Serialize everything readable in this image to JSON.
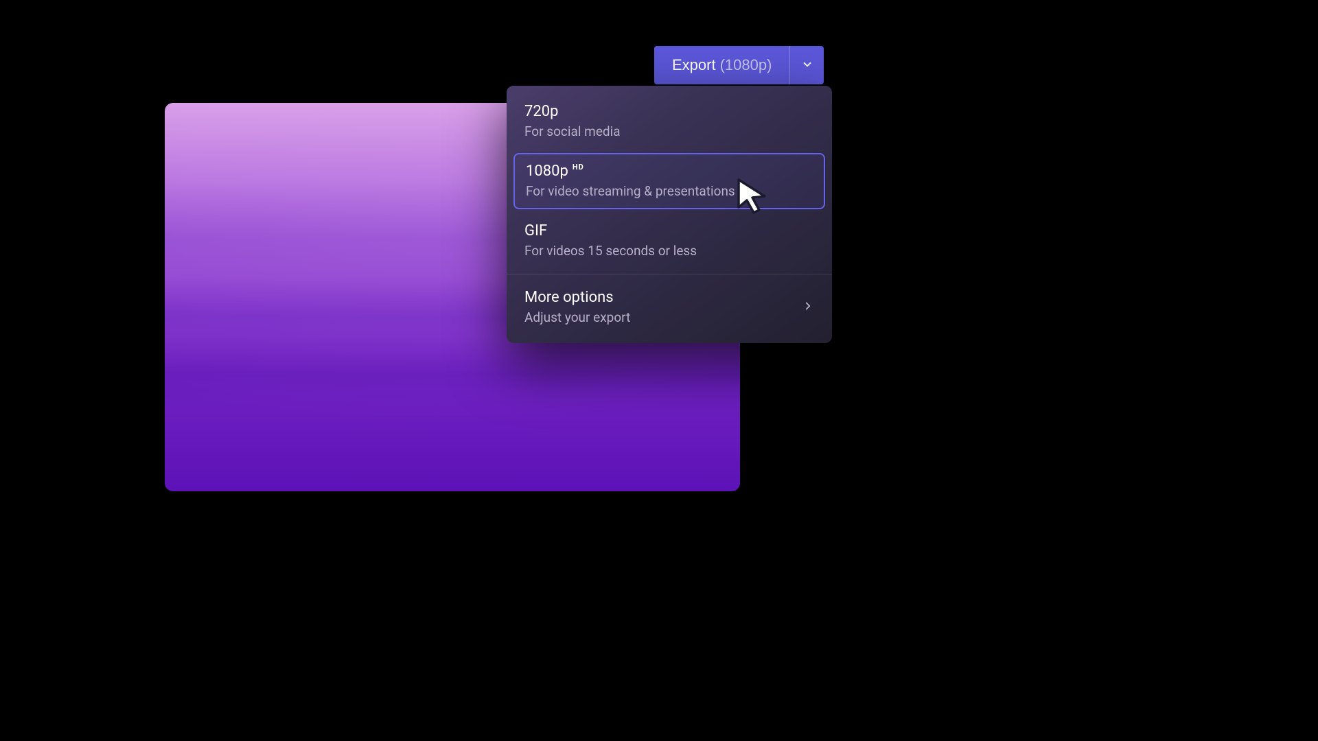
{
  "export_button": {
    "label": "Export",
    "resolution_label": "(1080p)"
  },
  "dropdown": {
    "items": [
      {
        "title": "720p",
        "subtitle": "For social media",
        "selected": false
      },
      {
        "title": "1080p",
        "badge": "HD",
        "subtitle": "For video streaming & presentations",
        "selected": true
      },
      {
        "title": "GIF",
        "subtitle": "For videos 15 seconds or less",
        "selected": false
      }
    ],
    "more": {
      "title": "More options",
      "subtitle": "Adjust your export"
    }
  },
  "colors": {
    "accent": "#5b57d9",
    "selection_border": "#6763e6"
  }
}
